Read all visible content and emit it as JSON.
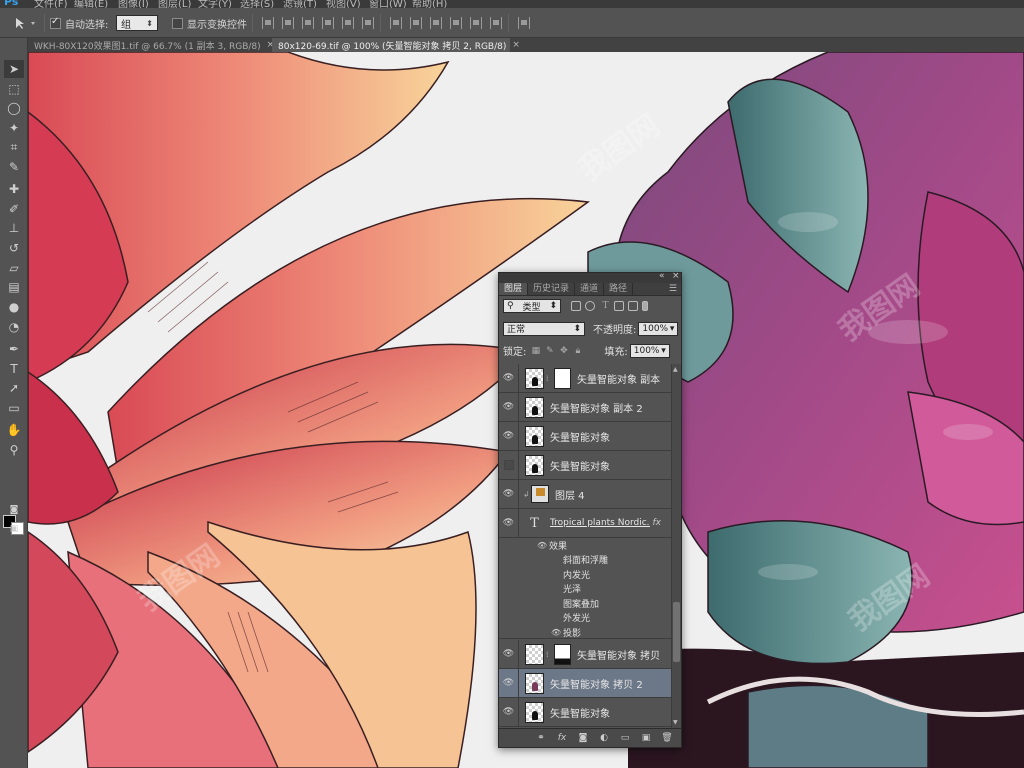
{
  "app": {
    "name": "Ps"
  },
  "menubar": {
    "items": [
      "文件(F)",
      "编辑(E)",
      "图像(I)",
      "图层(L)",
      "文字(Y)",
      "选择(S)",
      "滤镜(T)",
      "视图(V)",
      "窗口(W)",
      "帮助(H)"
    ]
  },
  "options": {
    "auto_select_label": "自动选择:",
    "auto_select_value": "组",
    "show_transform_label": "显示变换控件"
  },
  "tabs": [
    {
      "label": "WKH-80X120效果图1.tif @ 66.7% (1 副本 3, RGB/8)",
      "close": "×"
    },
    {
      "label": "80x120-69.tif @ 100% (矢量智能对象 拷贝 2, RGB/8)",
      "close": "×"
    }
  ],
  "tools": [
    "move-tool-icon",
    "marquee-icon",
    "lasso-icon",
    "magic-wand-icon",
    "crop-icon",
    "eyedropper-icon",
    "healing-icon",
    "brush-icon",
    "stamp-icon",
    "history-brush-icon",
    "eraser-icon",
    "gradient-icon",
    "blur-icon",
    "dodge-icon",
    "pen-icon",
    "type-icon",
    "path-select-icon",
    "shape-icon",
    "hand-icon",
    "zoom-icon"
  ],
  "layers_panel": {
    "tabs": [
      "图层",
      "历史记录",
      "通道",
      "路径"
    ],
    "filter_kind": "类型",
    "blend_mode": "正常",
    "opacity_label": "不透明度:",
    "opacity_value": "100%",
    "lock_label": "锁定:",
    "fill_label": "填充:",
    "fill_value": "100%",
    "layers": [
      {
        "name": "矢量智能对象 副本",
        "visible": true,
        "mask": true
      },
      {
        "name": "矢量智能对象 副本 2",
        "visible": true
      },
      {
        "name": "矢量智能对象",
        "visible": true
      },
      {
        "name": "矢量智能对象",
        "visible": false
      },
      {
        "name": "图层 4",
        "visible": true
      },
      {
        "name": "Tropical plants Nordic...",
        "visible": true,
        "type": "text",
        "fx": "fx"
      },
      {
        "name": "矢量智能对象 拷贝",
        "visible": true,
        "mask": true
      },
      {
        "name": "矢量智能对象 拷贝 2",
        "visible": true,
        "selected": true
      },
      {
        "name": "矢量智能对象",
        "visible": true
      }
    ],
    "effects_label": "效果",
    "effects": [
      "斜面和浮雕",
      "内发光",
      "光泽",
      "图案叠加",
      "外发光",
      "投影"
    ]
  },
  "watermark": "我图网"
}
